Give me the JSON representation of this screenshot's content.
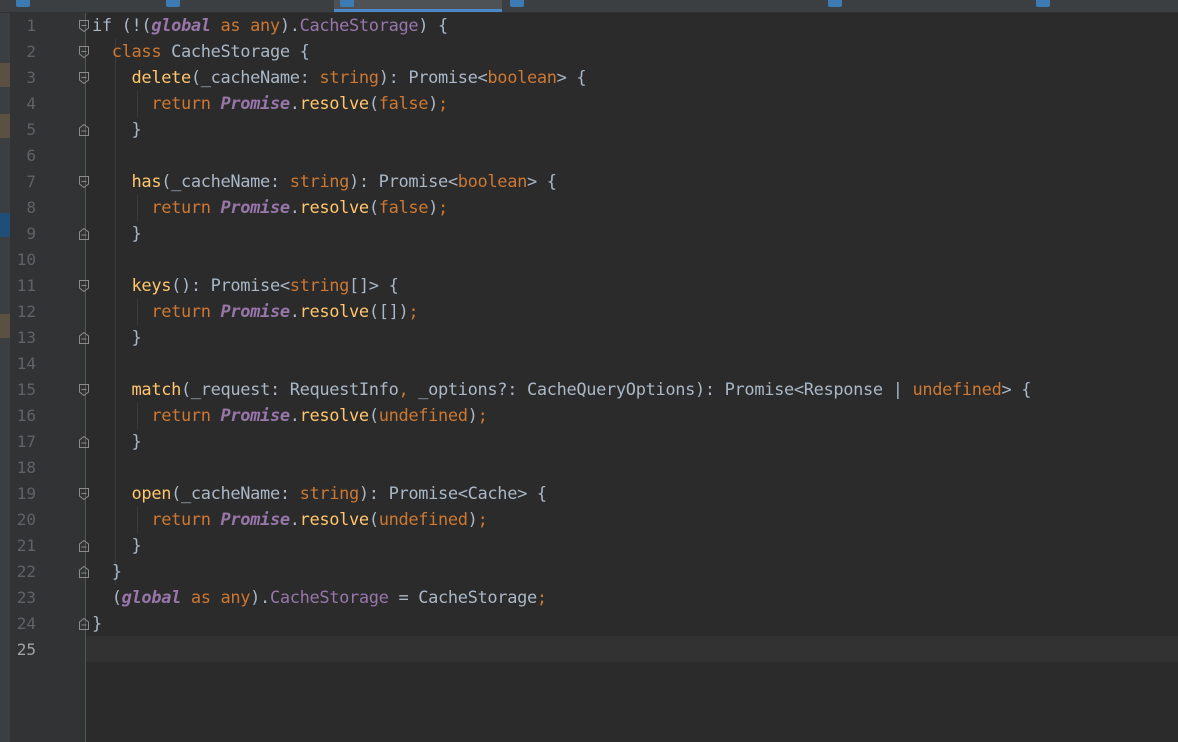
{
  "editor": {
    "language": "TypeScript",
    "current_line": 25,
    "colors": {
      "background": "#2b2b2b",
      "gutter": "#313335",
      "keyword": "#cc7832",
      "function": "#ffc66d",
      "global": "#9876aa",
      "property": "#9876aa",
      "text": "#a9b7c6",
      "line_number": "#606366",
      "tab_accent": "#4a88c7"
    },
    "tabs": [
      {
        "icon": "typescript-file-icon",
        "label": "",
        "active": false
      },
      {
        "icon": "typescript-file-icon",
        "label": "",
        "active": false
      },
      {
        "icon": "typescript-file-icon",
        "label": "",
        "active": true
      },
      {
        "icon": "typescript-file-icon",
        "label": "",
        "active": false
      },
      {
        "icon": "typescript-file-icon",
        "label": "",
        "active": false
      },
      {
        "icon": "typescript-file-icon",
        "label": "",
        "active": false
      }
    ],
    "lines": [
      {
        "no": "1",
        "tokens": [
          {
            "t": "if (!(",
            "c": "par"
          },
          {
            "t": "global",
            "c": "gl"
          },
          {
            "t": " as any",
            "c": "kw"
          },
          {
            "t": ").",
            "c": "par"
          },
          {
            "t": "CacheStorage",
            "c": "pr"
          },
          {
            "t": ") {",
            "c": "par"
          }
        ]
      },
      {
        "no": "2",
        "tokens": [
          {
            "t": "  ",
            "c": "par"
          },
          {
            "t": "class",
            "c": "kw"
          },
          {
            "t": " CacheStorage {",
            "c": "par"
          }
        ]
      },
      {
        "no": "3",
        "tokens": [
          {
            "t": "    ",
            "c": "par"
          },
          {
            "t": "delete",
            "c": "fn"
          },
          {
            "t": "(_cacheName: ",
            "c": "par"
          },
          {
            "t": "string",
            "c": "kw"
          },
          {
            "t": "): Promise<",
            "c": "par"
          },
          {
            "t": "boolean",
            "c": "kw"
          },
          {
            "t": "> {",
            "c": "par"
          }
        ]
      },
      {
        "no": "4",
        "tokens": [
          {
            "t": "      ",
            "c": "par"
          },
          {
            "t": "return",
            "c": "kw"
          },
          {
            "t": " ",
            "c": "par"
          },
          {
            "t": "Promise",
            "c": "gl"
          },
          {
            "t": ".",
            "c": "par"
          },
          {
            "t": "resolve",
            "c": "fn"
          },
          {
            "t": "(",
            "c": "par"
          },
          {
            "t": "false",
            "c": "kw"
          },
          {
            "t": ")",
            "c": "par"
          },
          {
            "t": ";",
            "c": "kw"
          }
        ]
      },
      {
        "no": "5",
        "tokens": [
          {
            "t": "    }",
            "c": "par"
          }
        ]
      },
      {
        "no": "6",
        "tokens": []
      },
      {
        "no": "7",
        "tokens": [
          {
            "t": "    ",
            "c": "par"
          },
          {
            "t": "has",
            "c": "fn"
          },
          {
            "t": "(_cacheName: ",
            "c": "par"
          },
          {
            "t": "string",
            "c": "kw"
          },
          {
            "t": "): Promise<",
            "c": "par"
          },
          {
            "t": "boolean",
            "c": "kw"
          },
          {
            "t": "> {",
            "c": "par"
          }
        ]
      },
      {
        "no": "8",
        "tokens": [
          {
            "t": "      ",
            "c": "par"
          },
          {
            "t": "return",
            "c": "kw"
          },
          {
            "t": " ",
            "c": "par"
          },
          {
            "t": "Promise",
            "c": "gl"
          },
          {
            "t": ".",
            "c": "par"
          },
          {
            "t": "resolve",
            "c": "fn"
          },
          {
            "t": "(",
            "c": "par"
          },
          {
            "t": "false",
            "c": "kw"
          },
          {
            "t": ")",
            "c": "par"
          },
          {
            "t": ";",
            "c": "kw"
          }
        ]
      },
      {
        "no": "9",
        "tokens": [
          {
            "t": "    }",
            "c": "par"
          }
        ]
      },
      {
        "no": "10",
        "tokens": []
      },
      {
        "no": "11",
        "tokens": [
          {
            "t": "    ",
            "c": "par"
          },
          {
            "t": "keys",
            "c": "fn"
          },
          {
            "t": "(): Promise<",
            "c": "par"
          },
          {
            "t": "string",
            "c": "kw"
          },
          {
            "t": "[]> {",
            "c": "par"
          }
        ]
      },
      {
        "no": "12",
        "tokens": [
          {
            "t": "      ",
            "c": "par"
          },
          {
            "t": "return",
            "c": "kw"
          },
          {
            "t": " ",
            "c": "par"
          },
          {
            "t": "Promise",
            "c": "gl"
          },
          {
            "t": ".",
            "c": "par"
          },
          {
            "t": "resolve",
            "c": "fn"
          },
          {
            "t": "([])",
            "c": "par"
          },
          {
            "t": ";",
            "c": "kw"
          }
        ]
      },
      {
        "no": "13",
        "tokens": [
          {
            "t": "    }",
            "c": "par"
          }
        ]
      },
      {
        "no": "14",
        "tokens": []
      },
      {
        "no": "15",
        "tokens": [
          {
            "t": "    ",
            "c": "par"
          },
          {
            "t": "match",
            "c": "fn"
          },
          {
            "t": "(_request: RequestInfo",
            "c": "par"
          },
          {
            "t": ",",
            "c": "kw"
          },
          {
            "t": " _options?: CacheQueryOptions): Promise<Response | ",
            "c": "par"
          },
          {
            "t": "undefined",
            "c": "kw"
          },
          {
            "t": "> {",
            "c": "par"
          }
        ]
      },
      {
        "no": "16",
        "tokens": [
          {
            "t": "      ",
            "c": "par"
          },
          {
            "t": "return",
            "c": "kw"
          },
          {
            "t": " ",
            "c": "par"
          },
          {
            "t": "Promise",
            "c": "gl"
          },
          {
            "t": ".",
            "c": "par"
          },
          {
            "t": "resolve",
            "c": "fn"
          },
          {
            "t": "(",
            "c": "par"
          },
          {
            "t": "undefined",
            "c": "kw"
          },
          {
            "t": ")",
            "c": "par"
          },
          {
            "t": ";",
            "c": "kw"
          }
        ]
      },
      {
        "no": "17",
        "tokens": [
          {
            "t": "    }",
            "c": "par"
          }
        ]
      },
      {
        "no": "18",
        "tokens": []
      },
      {
        "no": "19",
        "tokens": [
          {
            "t": "    ",
            "c": "par"
          },
          {
            "t": "open",
            "c": "fn"
          },
          {
            "t": "(_cacheName: ",
            "c": "par"
          },
          {
            "t": "string",
            "c": "kw"
          },
          {
            "t": "): Promise<Cache> {",
            "c": "par"
          }
        ]
      },
      {
        "no": "20",
        "tokens": [
          {
            "t": "      ",
            "c": "par"
          },
          {
            "t": "return",
            "c": "kw"
          },
          {
            "t": " ",
            "c": "par"
          },
          {
            "t": "Promise",
            "c": "gl"
          },
          {
            "t": ".",
            "c": "par"
          },
          {
            "t": "resolve",
            "c": "fn"
          },
          {
            "t": "(",
            "c": "par"
          },
          {
            "t": "undefined",
            "c": "kw"
          },
          {
            "t": ")",
            "c": "par"
          },
          {
            "t": ";",
            "c": "kw"
          }
        ]
      },
      {
        "no": "21",
        "tokens": [
          {
            "t": "    }",
            "c": "par"
          }
        ]
      },
      {
        "no": "22",
        "tokens": [
          {
            "t": "  }",
            "c": "par"
          }
        ]
      },
      {
        "no": "23",
        "tokens": [
          {
            "t": "  (",
            "c": "par"
          },
          {
            "t": "global",
            "c": "gl"
          },
          {
            "t": " as any",
            "c": "kw"
          },
          {
            "t": ").",
            "c": "par"
          },
          {
            "t": "CacheStorage",
            "c": "pr"
          },
          {
            "t": " = CacheStorage",
            "c": "par"
          },
          {
            "t": ";",
            "c": "kw"
          }
        ]
      },
      {
        "no": "24",
        "tokens": [
          {
            "t": "}",
            "c": "par"
          }
        ]
      },
      {
        "no": "25",
        "tokens": []
      }
    ]
  }
}
